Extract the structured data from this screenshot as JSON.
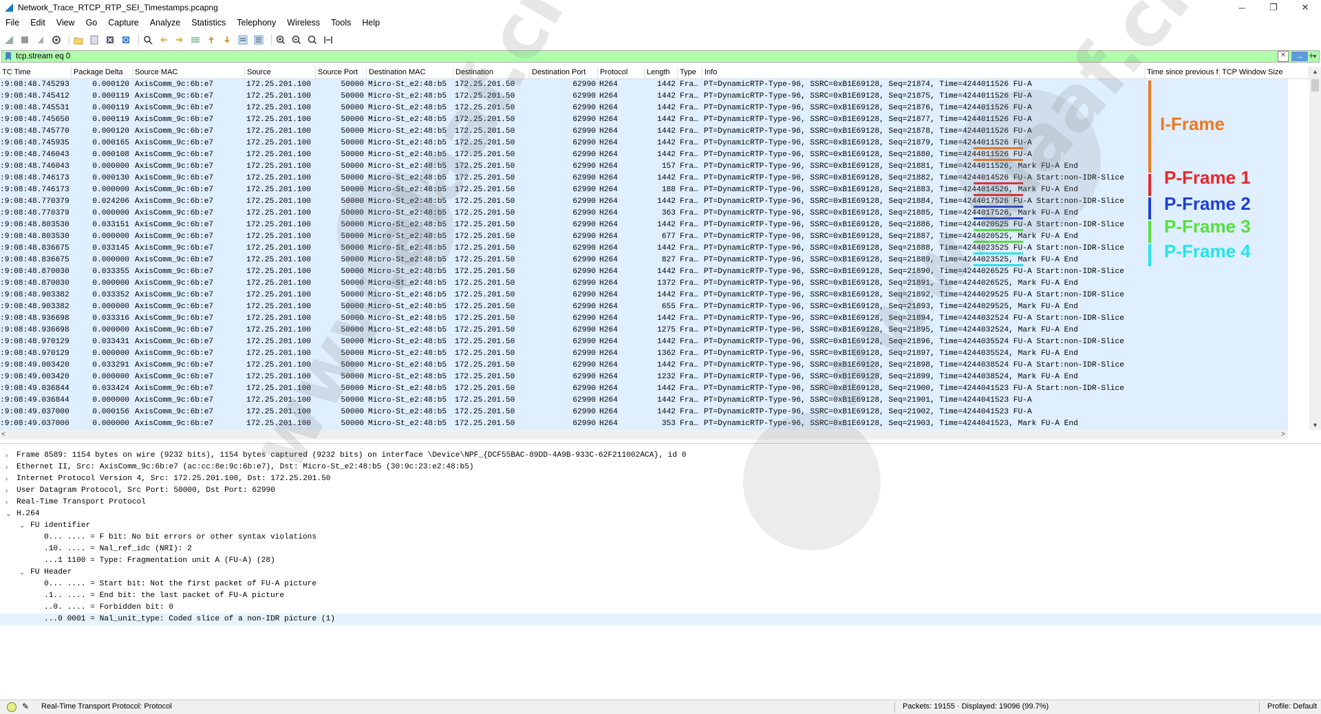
{
  "window": {
    "title": "Network_Trace_RTCP_RTP_SEI_Timestamps.pcapng",
    "min": "─",
    "max": "❐",
    "close": "✕"
  },
  "menu": [
    "File",
    "Edit",
    "View",
    "Go",
    "Capture",
    "Analyze",
    "Statistics",
    "Telephony",
    "Wireless",
    "Tools",
    "Help"
  ],
  "filter": {
    "value": "tcp.stream eq 0"
  },
  "columns": [
    {
      "name": "UTC Time",
      "display": "TC Time"
    },
    {
      "name": "Package Delta",
      "display": "Package Delta"
    },
    {
      "name": "Source MAC",
      "display": "Source MAC"
    },
    {
      "name": "Source",
      "display": "Source"
    },
    {
      "name": "Source Port",
      "display": "Source Port"
    },
    {
      "name": "Destination MAC",
      "display": "Destination MAC"
    },
    {
      "name": "Destination",
      "display": "Destination"
    },
    {
      "name": "Destination Port",
      "display": "Destination Port"
    },
    {
      "name": "Protocol",
      "display": "Protocol"
    },
    {
      "name": "Length",
      "display": "Length"
    },
    {
      "name": "Type",
      "display": "Type"
    },
    {
      "name": "Info",
      "display": "Info"
    },
    {
      "name": "Time since previous f",
      "display": "Time since previous f"
    },
    {
      "name": "TCP Window Size",
      "display": "TCP Window Size"
    }
  ],
  "packets": [
    {
      "time": ":9:08:48.745293",
      "delta": "0.000120",
      "smac": "AxisComm_9c:6b:e7",
      "src": "172.25.201.100",
      "sport": "50000",
      "dmac": "Micro-St_e2:48:b5",
      "dst": "172.25.201.50",
      "dport": "62990",
      "proto": "H264",
      "len": "1442",
      "type": "Fra…",
      "info": "PT=DynamicRTP-Type-96, SSRC=0xB1E69128, Seq=21874, Time=4244011526 FU-A"
    },
    {
      "time": ":9:08:48.745412",
      "delta": "0.000119",
      "smac": "AxisComm_9c:6b:e7",
      "src": "172.25.201.100",
      "sport": "50000",
      "dmac": "Micro-St_e2:48:b5",
      "dst": "172.25.201.50",
      "dport": "62990",
      "proto": "H264",
      "len": "1442",
      "type": "Fra…",
      "info": "PT=DynamicRTP-Type-96, SSRC=0xB1E69128, Seq=21875, Time=4244011526 FU-A"
    },
    {
      "time": ":9:08:48.745531",
      "delta": "0.000119",
      "smac": "AxisComm_9c:6b:e7",
      "src": "172.25.201.100",
      "sport": "50000",
      "dmac": "Micro-St_e2:48:b5",
      "dst": "172.25.201.50",
      "dport": "62990",
      "proto": "H264",
      "len": "1442",
      "type": "Fra…",
      "info": "PT=DynamicRTP-Type-96, SSRC=0xB1E69128, Seq=21876, Time=4244011526 FU-A"
    },
    {
      "time": ":9:08:48.745650",
      "delta": "0.000119",
      "smac": "AxisComm_9c:6b:e7",
      "src": "172.25.201.100",
      "sport": "50000",
      "dmac": "Micro-St_e2:48:b5",
      "dst": "172.25.201.50",
      "dport": "62990",
      "proto": "H264",
      "len": "1442",
      "type": "Fra…",
      "info": "PT=DynamicRTP-Type-96, SSRC=0xB1E69128, Seq=21877, Time=4244011526 FU-A"
    },
    {
      "time": ":9:08:48.745770",
      "delta": "0.000120",
      "smac": "AxisComm_9c:6b:e7",
      "src": "172.25.201.100",
      "sport": "50000",
      "dmac": "Micro-St_e2:48:b5",
      "dst": "172.25.201.50",
      "dport": "62990",
      "proto": "H264",
      "len": "1442",
      "type": "Fra…",
      "info": "PT=DynamicRTP-Type-96, SSRC=0xB1E69128, Seq=21878, Time=4244011526 FU-A"
    },
    {
      "time": ":9:08:48.745935",
      "delta": "0.000165",
      "smac": "AxisComm_9c:6b:e7",
      "src": "172.25.201.100",
      "sport": "50000",
      "dmac": "Micro-St_e2:48:b5",
      "dst": "172.25.201.50",
      "dport": "62990",
      "proto": "H264",
      "len": "1442",
      "type": "Fra…",
      "info": "PT=DynamicRTP-Type-96, SSRC=0xB1E69128, Seq=21879, Time=4244011526 FU-A"
    },
    {
      "time": ":9:08:48.746043",
      "delta": "0.000108",
      "smac": "AxisComm_9c:6b:e7",
      "src": "172.25.201.100",
      "sport": "50000",
      "dmac": "Micro-St_e2:48:b5",
      "dst": "172.25.201.50",
      "dport": "62990",
      "proto": "H264",
      "len": "1442",
      "type": "Fra…",
      "info": "PT=DynamicRTP-Type-96, SSRC=0xB1E69128, Seq=21880, Time=4244011526 FU-A"
    },
    {
      "time": ":9:08:48.746043",
      "delta": "0.000000",
      "smac": "AxisComm_9c:6b:e7",
      "src": "172.25.201.100",
      "sport": "50000",
      "dmac": "Micro-St_e2:48:b5",
      "dst": "172.25.201.50",
      "dport": "62990",
      "proto": "H264",
      "len": "157",
      "type": "Fra…",
      "info": "PT=DynamicRTP-Type-96, SSRC=0xB1E69128, Seq=21881, Time=4244011526, Mark FU-A End"
    },
    {
      "time": ":9:08:48.746173",
      "delta": "0.000130",
      "smac": "AxisComm_9c:6b:e7",
      "src": "172.25.201.100",
      "sport": "50000",
      "dmac": "Micro-St_e2:48:b5",
      "dst": "172.25.201.50",
      "dport": "62990",
      "proto": "H264",
      "len": "1442",
      "type": "Fra…",
      "info": "PT=DynamicRTP-Type-96, SSRC=0xB1E69128, Seq=21882, Time=4244014526 FU-A Start:non-IDR-Slice"
    },
    {
      "time": ":9:08:48.746173",
      "delta": "0.000000",
      "smac": "AxisComm_9c:6b:e7",
      "src": "172.25.201.100",
      "sport": "50000",
      "dmac": "Micro-St_e2:48:b5",
      "dst": "172.25.201.50",
      "dport": "62990",
      "proto": "H264",
      "len": "188",
      "type": "Fra…",
      "info": "PT=DynamicRTP-Type-96, SSRC=0xB1E69128, Seq=21883, Time=4244014526, Mark FU-A End"
    },
    {
      "time": ":9:08:48.770379",
      "delta": "0.024206",
      "smac": "AxisComm_9c:6b:e7",
      "src": "172.25.201.100",
      "sport": "50000",
      "dmac": "Micro-St_e2:48:b5",
      "dst": "172.25.201.50",
      "dport": "62990",
      "proto": "H264",
      "len": "1442",
      "type": "Fra…",
      "info": "PT=DynamicRTP-Type-96, SSRC=0xB1E69128, Seq=21884, Time=4244017526 FU-A Start:non-IDR-Slice"
    },
    {
      "time": ":9:08:48.770379",
      "delta": "0.000000",
      "smac": "AxisComm_9c:6b:e7",
      "src": "172.25.201.100",
      "sport": "50000",
      "dmac": "Micro-St_e2:48:b5",
      "dst": "172.25.201.50",
      "dport": "62990",
      "proto": "H264",
      "len": "363",
      "type": "Fra…",
      "info": "PT=DynamicRTP-Type-96, SSRC=0xB1E69128, Seq=21885, Time=4244017526, Mark FU-A End"
    },
    {
      "time": ":9:08:48.803530",
      "delta": "0.033151",
      "smac": "AxisComm_9c:6b:e7",
      "src": "172.25.201.100",
      "sport": "50000",
      "dmac": "Micro-St_e2:48:b5",
      "dst": "172.25.201.50",
      "dport": "62990",
      "proto": "H264",
      "len": "1442",
      "type": "Fra…",
      "info": "PT=DynamicRTP-Type-96, SSRC=0xB1E69128, Seq=21886, Time=4244020525 FU-A Start:non-IDR-Slice"
    },
    {
      "time": ":9:08:48.803530",
      "delta": "0.000000",
      "smac": "AxisComm_9c:6b:e7",
      "src": "172.25.201.100",
      "sport": "50000",
      "dmac": "Micro-St_e2:48:b5",
      "dst": "172.25.201.50",
      "dport": "62990",
      "proto": "H264",
      "len": "677",
      "type": "Fra…",
      "info": "PT=DynamicRTP-Type-96, SSRC=0xB1E69128, Seq=21887, Time=4244020525, Mark FU-A End"
    },
    {
      "time": ":9:08:48.836675",
      "delta": "0.033145",
      "smac": "AxisComm_9c:6b:e7",
      "src": "172.25.201.100",
      "sport": "50000",
      "dmac": "Micro-St_e2:48:b5",
      "dst": "172.25.201.50",
      "dport": "62990",
      "proto": "H264",
      "len": "1442",
      "type": "Fra…",
      "info": "PT=DynamicRTP-Type-96, SSRC=0xB1E69128, Seq=21888, Time=4244023525 FU-A Start:non-IDR-Slice"
    },
    {
      "time": ":9:08:48.836675",
      "delta": "0.000000",
      "smac": "AxisComm_9c:6b:e7",
      "src": "172.25.201.100",
      "sport": "50000",
      "dmac": "Micro-St_e2:48:b5",
      "dst": "172.25.201.50",
      "dport": "62990",
      "proto": "H264",
      "len": "827",
      "type": "Fra…",
      "info": "PT=DynamicRTP-Type-96, SSRC=0xB1E69128, Seq=21889, Time=4244023525, Mark FU-A End"
    },
    {
      "time": ":9:08:48.870030",
      "delta": "0.033355",
      "smac": "AxisComm_9c:6b:e7",
      "src": "172.25.201.100",
      "sport": "50000",
      "dmac": "Micro-St_e2:48:b5",
      "dst": "172.25.201.50",
      "dport": "62990",
      "proto": "H264",
      "len": "1442",
      "type": "Fra…",
      "info": "PT=DynamicRTP-Type-96, SSRC=0xB1E69128, Seq=21890, Time=4244026525 FU-A Start:non-IDR-Slice"
    },
    {
      "time": ":9:08:48.870030",
      "delta": "0.000000",
      "smac": "AxisComm_9c:6b:e7",
      "src": "172.25.201.100",
      "sport": "50000",
      "dmac": "Micro-St_e2:48:b5",
      "dst": "172.25.201.50",
      "dport": "62990",
      "proto": "H264",
      "len": "1372",
      "type": "Fra…",
      "info": "PT=DynamicRTP-Type-96, SSRC=0xB1E69128, Seq=21891, Time=4244026525, Mark FU-A End"
    },
    {
      "time": ":9:08:48.903382",
      "delta": "0.033352",
      "smac": "AxisComm_9c:6b:e7",
      "src": "172.25.201.100",
      "sport": "50000",
      "dmac": "Micro-St_e2:48:b5",
      "dst": "172.25.201.50",
      "dport": "62990",
      "proto": "H264",
      "len": "1442",
      "type": "Fra…",
      "info": "PT=DynamicRTP-Type-96, SSRC=0xB1E69128, Seq=21892, Time=4244029525 FU-A Start:non-IDR-Slice"
    },
    {
      "time": ":9:08:48.903382",
      "delta": "0.000000",
      "smac": "AxisComm_9c:6b:e7",
      "src": "172.25.201.100",
      "sport": "50000",
      "dmac": "Micro-St_e2:48:b5",
      "dst": "172.25.201.50",
      "dport": "62990",
      "proto": "H264",
      "len": "655",
      "type": "Fra…",
      "info": "PT=DynamicRTP-Type-96, SSRC=0xB1E69128, Seq=21893, Time=4244029525, Mark FU-A End"
    },
    {
      "time": ":9:08:48.936698",
      "delta": "0.033316",
      "smac": "AxisComm_9c:6b:e7",
      "src": "172.25.201.100",
      "sport": "50000",
      "dmac": "Micro-St_e2:48:b5",
      "dst": "172.25.201.50",
      "dport": "62990",
      "proto": "H264",
      "len": "1442",
      "type": "Fra…",
      "info": "PT=DynamicRTP-Type-96, SSRC=0xB1E69128, Seq=21894, Time=4244032524 FU-A Start:non-IDR-Slice"
    },
    {
      "time": ":9:08:48.936698",
      "delta": "0.000000",
      "smac": "AxisComm_9c:6b:e7",
      "src": "172.25.201.100",
      "sport": "50000",
      "dmac": "Micro-St_e2:48:b5",
      "dst": "172.25.201.50",
      "dport": "62990",
      "proto": "H264",
      "len": "1275",
      "type": "Fra…",
      "info": "PT=DynamicRTP-Type-96, SSRC=0xB1E69128, Seq=21895, Time=4244032524, Mark FU-A End"
    },
    {
      "time": ":9:08:48.970129",
      "delta": "0.033431",
      "smac": "AxisComm_9c:6b:e7",
      "src": "172.25.201.100",
      "sport": "50000",
      "dmac": "Micro-St_e2:48:b5",
      "dst": "172.25.201.50",
      "dport": "62990",
      "proto": "H264",
      "len": "1442",
      "type": "Fra…",
      "info": "PT=DynamicRTP-Type-96, SSRC=0xB1E69128, Seq=21896, Time=4244035524 FU-A Start:non-IDR-Slice"
    },
    {
      "time": ":9:08:48.970129",
      "delta": "0.000000",
      "smac": "AxisComm_9c:6b:e7",
      "src": "172.25.201.100",
      "sport": "50000",
      "dmac": "Micro-St_e2:48:b5",
      "dst": "172.25.201.50",
      "dport": "62990",
      "proto": "H264",
      "len": "1362",
      "type": "Fra…",
      "info": "PT=DynamicRTP-Type-96, SSRC=0xB1E69128, Seq=21897, Time=4244035524, Mark FU-A End"
    },
    {
      "time": ":9:08:49.003420",
      "delta": "0.033291",
      "smac": "AxisComm_9c:6b:e7",
      "src": "172.25.201.100",
      "sport": "50000",
      "dmac": "Micro-St_e2:48:b5",
      "dst": "172.25.201.50",
      "dport": "62990",
      "proto": "H264",
      "len": "1442",
      "type": "Fra…",
      "info": "PT=DynamicRTP-Type-96, SSRC=0xB1E69128, Seq=21898, Time=4244038524 FU-A Start:non-IDR-Slice"
    },
    {
      "time": ":9:08:49.003420",
      "delta": "0.000000",
      "smac": "AxisComm_9c:6b:e7",
      "src": "172.25.201.100",
      "sport": "50000",
      "dmac": "Micro-St_e2:48:b5",
      "dst": "172.25.201.50",
      "dport": "62990",
      "proto": "H264",
      "len": "1232",
      "type": "Fra…",
      "info": "PT=DynamicRTP-Type-96, SSRC=0xB1E69128, Seq=21899, Time=4244038524, Mark FU-A End"
    },
    {
      "time": ":9:08:49.036844",
      "delta": "0.033424",
      "smac": "AxisComm_9c:6b:e7",
      "src": "172.25.201.100",
      "sport": "50000",
      "dmac": "Micro-St_e2:48:b5",
      "dst": "172.25.201.50",
      "dport": "62990",
      "proto": "H264",
      "len": "1442",
      "type": "Fra…",
      "info": "PT=DynamicRTP-Type-96, SSRC=0xB1E69128, Seq=21900, Time=4244041523 FU-A Start:non-IDR-Slice"
    },
    {
      "time": ":9:08:49.036844",
      "delta": "0.000000",
      "smac": "AxisComm_9c:6b:e7",
      "src": "172.25.201.100",
      "sport": "50000",
      "dmac": "Micro-St_e2:48:b5",
      "dst": "172.25.201.50",
      "dport": "62990",
      "proto": "H264",
      "len": "1442",
      "type": "Fra…",
      "info": "PT=DynamicRTP-Type-96, SSRC=0xB1E69128, Seq=21901, Time=4244041523 FU-A"
    },
    {
      "time": ":9:08:49.037000",
      "delta": "0.000156",
      "smac": "AxisComm_9c:6b:e7",
      "src": "172.25.201.100",
      "sport": "50000",
      "dmac": "Micro-St_e2:48:b5",
      "dst": "172.25.201.50",
      "dport": "62990",
      "proto": "H264",
      "len": "1442",
      "type": "Fra…",
      "info": "PT=DynamicRTP-Type-96, SSRC=0xB1E69128, Seq=21902, Time=4244041523 FU-A"
    },
    {
      "time": ":9:08:49.037000",
      "delta": "0.000000",
      "smac": "AxisComm_9c:6b:e7",
      "src": "172.25.201.100",
      "sport": "50000",
      "dmac": "Micro-St_e2:48:b5",
      "dst": "172.25.201.50",
      "dport": "62990",
      "proto": "H264",
      "len": "353",
      "type": "Fra…",
      "info": "PT=DynamicRTP-Type-96, SSRC=0xB1E69128, Seq=21903, Time=4244041523, Mark FU-A End"
    }
  ],
  "details": [
    {
      "indent": 0,
      "expander": "›",
      "text": "Frame 8589: 1154 bytes on wire (9232 bits), 1154 bytes captured (9232 bits) on interface \\Device\\NPF_{DCF55BAC-89DD-4A9B-933C-62F211002ACA}, id 0"
    },
    {
      "indent": 0,
      "expander": "›",
      "text": "Ethernet II, Src: AxisComm_9c:6b:e7 (ac:cc:8e:9c:6b:e7), Dst: Micro-St_e2:48:b5 (30:9c:23:e2:48:b5)"
    },
    {
      "indent": 0,
      "expander": "›",
      "text": "Internet Protocol Version 4, Src: 172.25.201.100, Dst: 172.25.201.50"
    },
    {
      "indent": 0,
      "expander": "›",
      "text": "User Datagram Protocol, Src Port: 50000, Dst Port: 62990"
    },
    {
      "indent": 0,
      "expander": "›",
      "text": "Real-Time Transport Protocol"
    },
    {
      "indent": 0,
      "expander": "⌄",
      "text": "H.264"
    },
    {
      "indent": 1,
      "expander": "⌄",
      "text": "FU identifier"
    },
    {
      "indent": 2,
      "expander": "",
      "text": "0... .... = F bit: No bit errors or other syntax violations"
    },
    {
      "indent": 2,
      "expander": "",
      "text": ".10. .... = Nal_ref_idc (NRI): 2"
    },
    {
      "indent": 2,
      "expander": "",
      "text": "...1 1100 = Type: Fragmentation unit A (FU-A) (28)"
    },
    {
      "indent": 1,
      "expander": "⌄",
      "text": "FU Header"
    },
    {
      "indent": 2,
      "expander": "",
      "text": "0... .... = Start bit: Not the first packet of FU-A picture"
    },
    {
      "indent": 2,
      "expander": "",
      "text": ".1.. .... = End bit: the last packet of FU-A picture"
    },
    {
      "indent": 2,
      "expander": "",
      "text": "..0. .... = Forbidden bit: 0"
    },
    {
      "indent": 2,
      "expander": "",
      "text": "...0 0001 = Nal_unit_type: Coded slice of a non-IDR picture (1)",
      "selected": true
    }
  ],
  "annotations": [
    {
      "label": "I-Frame",
      "color": "#f07820"
    },
    {
      "label": "P-Frame 1",
      "color": "#e8272a"
    },
    {
      "label": "P-Frame 2",
      "color": "#1f3fd6"
    },
    {
      "label": "P-Frame 3",
      "color": "#56e03a"
    },
    {
      "label": "P-Frame 4",
      "color": "#25e4e8"
    }
  ],
  "status": {
    "text": "Real-Time Transport Protocol: Protocol",
    "packets": "Packets: 19155 · Displayed: 19096 (99.7%)",
    "profile": "Profile: Default"
  },
  "watermark": {
    "text": "www.alaaf.cn"
  }
}
